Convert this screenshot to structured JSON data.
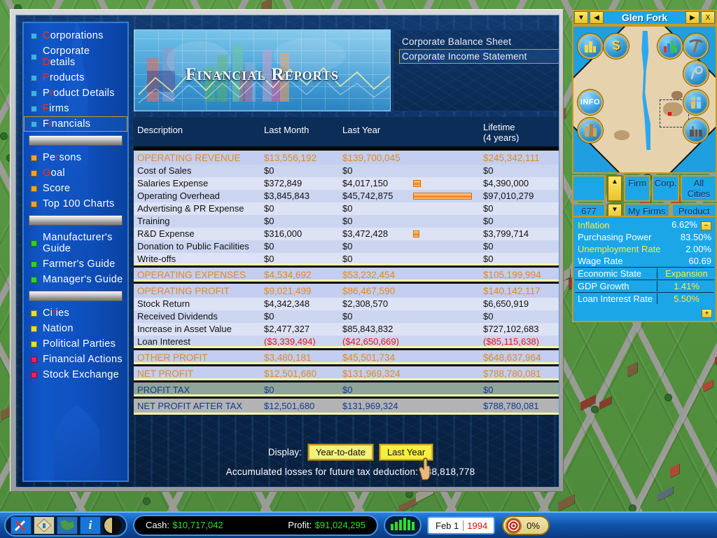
{
  "window": {
    "title": "Financial Reports"
  },
  "sidebar": {
    "items": [
      {
        "label": "Corporations",
        "hotkey_index": 0,
        "bullet": "#3cb0ee",
        "type": "item"
      },
      {
        "label": "Corporate Details",
        "hotkey_index": 10,
        "bullet": "#3cb0ee",
        "type": "item"
      },
      {
        "label": "Products",
        "hotkey_index": 0,
        "bullet": "#3cb0ee",
        "type": "item"
      },
      {
        "label": "Product Details",
        "hotkey_index": 1,
        "bullet": "#3cb0ee",
        "type": "item"
      },
      {
        "label": "Firms",
        "hotkey_index": 0,
        "bullet": "#3cb0ee",
        "type": "item"
      },
      {
        "label": "Financials",
        "hotkey_index": 1,
        "bullet": "#3cb0ee",
        "type": "item",
        "selected": true
      },
      {
        "type": "separator"
      },
      {
        "label": "Persons",
        "hotkey_index": 2,
        "bullet": "#f0a32a",
        "type": "item"
      },
      {
        "label": "Goal",
        "hotkey_index": 0,
        "bullet": "#f0a32a",
        "type": "item"
      },
      {
        "label": "Score",
        "hotkey_index": -1,
        "bullet": "#f0a32a",
        "type": "item"
      },
      {
        "label": "Top 100 Charts",
        "hotkey_index": -1,
        "bullet": "#f0a32a",
        "type": "item"
      },
      {
        "type": "separator"
      },
      {
        "label": "Manufacturer's Guide",
        "hotkey_index": -1,
        "bullet": "#34cc34",
        "type": "item"
      },
      {
        "label": "Farmer's Guide",
        "hotkey_index": -1,
        "bullet": "#34cc34",
        "type": "item"
      },
      {
        "label": "Manager's Guide",
        "hotkey_index": -1,
        "bullet": "#34cc34",
        "type": "item"
      },
      {
        "type": "separator"
      },
      {
        "label": "Cities",
        "hotkey_index": 2,
        "bullet": "#e8e02a",
        "type": "item"
      },
      {
        "label": "Nation",
        "hotkey_index": -1,
        "bullet": "#e8e02a",
        "type": "item"
      },
      {
        "label": "Political Parties",
        "hotkey_index": -1,
        "bullet": "#e8e02a",
        "type": "item"
      },
      {
        "label": "Financial Actions",
        "hotkey_index": -1,
        "bullet": "#ee1a6a",
        "type": "item"
      },
      {
        "label": "Stock Exchange",
        "hotkey_index": -1,
        "bullet": "#ee1a6a",
        "type": "item"
      }
    ]
  },
  "report_tabs": [
    {
      "label": "Corporate Balance Sheet",
      "active": false
    },
    {
      "label": "Corporate Income Statement",
      "active": true
    }
  ],
  "table": {
    "headers": [
      "Description",
      "Last Month",
      "Last Year",
      "Lifetime\n(4 years)"
    ],
    "header_lifetime_line1": "Lifetime",
    "header_lifetime_line2": "(4 years)",
    "rows": [
      {
        "kind": "total",
        "first": true,
        "desc": "OPERATING REVENUE",
        "last_month": "$13,556,192",
        "last_year": "$139,700,045",
        "lifetime": "$245,342,111"
      },
      {
        "kind": "alt",
        "desc": "Cost of Sales",
        "last_month": "$0",
        "last_year": "$0",
        "lifetime": "$0"
      },
      {
        "kind": "alt2",
        "desc": "Salaries Expense",
        "last_month": "$372,849",
        "last_year": "$4,017,150",
        "lifetime": "$4,390,000",
        "bar": 11
      },
      {
        "kind": "alt",
        "desc": "Operating Overhead",
        "last_month": "$3,845,843",
        "last_year": "$45,742,875",
        "lifetime": "$97,010,279",
        "bar": 84
      },
      {
        "kind": "alt2",
        "desc": "Advertising & PR Expense",
        "last_month": "$0",
        "last_year": "$0",
        "lifetime": "$0"
      },
      {
        "kind": "alt",
        "desc": "Training",
        "last_month": "$0",
        "last_year": "$0",
        "lifetime": "$0"
      },
      {
        "kind": "alt2",
        "desc": "R&D Expense",
        "last_month": "$316,000",
        "last_year": "$3,472,428",
        "lifetime": "$3,799,714",
        "bar": 9
      },
      {
        "kind": "alt",
        "desc": "Donation to Public Facilities",
        "last_month": "$0",
        "last_year": "$0",
        "lifetime": "$0"
      },
      {
        "kind": "alt2",
        "desc": "Write-offs",
        "last_month": "$0",
        "last_year": "$0",
        "lifetime": "$0"
      },
      {
        "kind": "total",
        "desc": "OPERATING EXPENSES",
        "last_month": "$4,534,692",
        "last_year": "$53,232,454",
        "lifetime": "$105,199,994"
      },
      {
        "kind": "total",
        "desc": "OPERATING PROFIT",
        "last_month": "$9,021,499",
        "last_year": "$86,467,590",
        "lifetime": "$140,142,117"
      },
      {
        "kind": "alt2",
        "desc": "Stock Return",
        "last_month": "$4,342,348",
        "last_year": "$2,308,570",
        "lifetime": "$6,650,919"
      },
      {
        "kind": "alt",
        "desc": "Received Dividends",
        "last_month": "$0",
        "last_year": "$0",
        "lifetime": "$0"
      },
      {
        "kind": "alt2",
        "desc": "Increase in Asset Value",
        "last_month": "$2,477,327",
        "last_year": "$85,843,832",
        "lifetime": "$727,102,683"
      },
      {
        "kind": "alt",
        "desc": "Loan Interest",
        "last_month": "($3,339,494)",
        "last_year": "($42,650,669)",
        "lifetime": "($85,115,638)",
        "negative": true
      },
      {
        "kind": "total",
        "desc": "OTHER PROFIT",
        "last_month": "$3,480,181",
        "last_year": "$45,501,734",
        "lifetime": "$648,637,964"
      },
      {
        "kind": "total",
        "desc": "NET PROFIT",
        "last_month": "$12,501,680",
        "last_year": "$131,969,324",
        "lifetime": "$788,780,081"
      },
      {
        "kind": "tax",
        "desc": "PROFIT TAX",
        "last_month": "$0",
        "last_year": "$0",
        "lifetime": "$0"
      },
      {
        "kind": "aftertax",
        "desc": "NET PROFIT AFTER TAX",
        "last_month": "$12,501,680",
        "last_year": "$131,969,324",
        "lifetime": "$788,780,081"
      }
    ]
  },
  "footer": {
    "display_label": "Display:",
    "buttons": [
      {
        "label": "Year-to-date",
        "selected": false
      },
      {
        "label": "Last Year",
        "selected": true
      }
    ],
    "accumulated_losses": "Accumulated losses for future tax deduction: $88,818,778"
  },
  "right_panel": {
    "city_name": "Glen Fork",
    "nav": {
      "down": "▼",
      "prev": "◀",
      "next": "▶",
      "close": "X"
    },
    "map_icons_left": [
      {
        "name": "city-icon",
        "glyph": "🏙"
      },
      {
        "name": "money-icon",
        "glyph": "$"
      },
      {
        "name": "info-icon",
        "glyph": "INFO"
      },
      {
        "name": "building-icon",
        "glyph": "🏢"
      }
    ],
    "map_icons_right": [
      {
        "name": "chart-icon",
        "glyph": "📊"
      },
      {
        "name": "mining-icon",
        "glyph": "⛏"
      },
      {
        "name": "farm-icon",
        "glyph": "🌾"
      },
      {
        "name": "people-icon",
        "glyph": "👥"
      },
      {
        "name": "factory-icon",
        "glyph": "🏭"
      }
    ],
    "buttons_row1": [
      "Firm",
      "Corp.",
      "All Cities"
    ],
    "buttons_row2": [
      "My Firms",
      "Product"
    ],
    "counter": "677",
    "economy": [
      {
        "key": "Inflation",
        "value": "6.62%",
        "key_color": "#ffec3a",
        "value_color": "#ffffff",
        "has_minus": true
      },
      {
        "key": "Purchasing Power",
        "value": "83.50%",
        "key_color": "#ffffff",
        "value_color": "#ffffff"
      },
      {
        "key": "Unemployment Rate",
        "value": "2.00%",
        "key_color": "#ffec3a",
        "value_color": "#ffffff"
      },
      {
        "key": "Wage Rate",
        "value": "60.69",
        "key_color": "#ffffff",
        "value_color": "#ffffff"
      }
    ],
    "economy_boxed": [
      {
        "key": "Economic State",
        "value": "Expansion",
        "key_color": "#ffffff",
        "value_color": "#ffec3a"
      },
      {
        "key": "GDP Growth",
        "value": "1.41%",
        "key_color": "#ffffff",
        "value_color": "#ffec3a"
      },
      {
        "key": "Loan Interest Rate",
        "value": "5.50%",
        "key_color": "#ffffff",
        "value_color": "#ffec3a"
      }
    ],
    "plus_button": "+",
    "minus_button": "−"
  },
  "bottom_bar": {
    "tool_icons": [
      {
        "name": "build-tools-icon",
        "glyph": "⚒"
      },
      {
        "name": "map-diamond-icon",
        "glyph": "◈"
      },
      {
        "name": "world-map-icon",
        "glyph": "🌎"
      },
      {
        "name": "info-icon",
        "glyph": "i"
      },
      {
        "name": "compass-icon",
        "glyph": "◐"
      }
    ],
    "cash_label": "Cash:",
    "cash_value": "$10,717,042",
    "profit_label": "Profit:",
    "profit_value": "$91,024,295",
    "speed_bars": 6,
    "date_day": "Feb 1",
    "date_year": "1994",
    "goal_percent": "0%"
  },
  "colors": {
    "accent_gold": "#c79b24",
    "header_orange": "#e08a22",
    "negative_red": "#e81414",
    "panel_blue": "#1ba6e8",
    "money_green": "#2be02b"
  }
}
